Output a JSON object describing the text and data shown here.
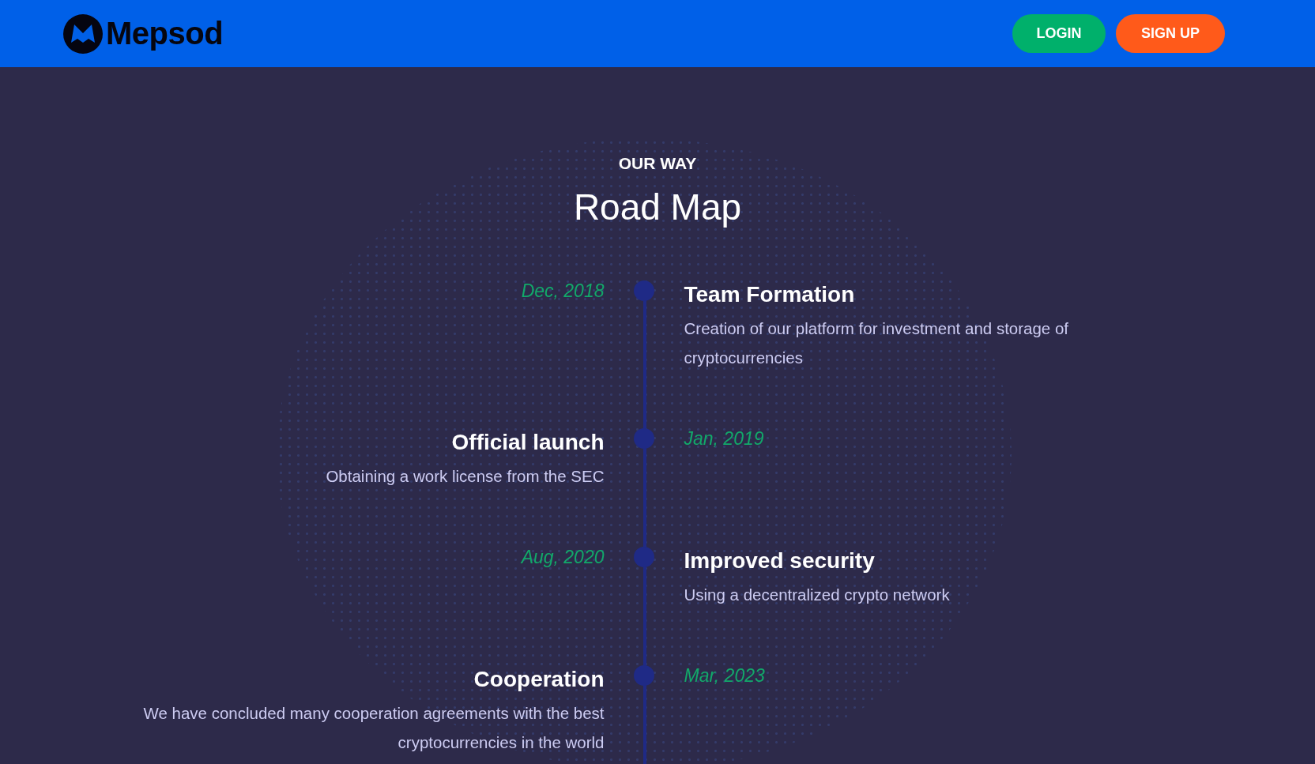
{
  "header": {
    "logo_text": "Mepsod",
    "buttons": [
      {
        "label": "LOGIN",
        "kind": "login"
      },
      {
        "label": "SIGN UP",
        "kind": "signup"
      }
    ]
  },
  "section": {
    "eyebrow": "OUR WAY",
    "title": "Road Map"
  },
  "milestones": [
    {
      "date": "Dec, 2018",
      "title": "Team Formation",
      "description": "Creation of our platform for investment and storage of cryptocurrencies",
      "text_on_left": false
    },
    {
      "date": "Jan, 2019",
      "title": "Official launch",
      "description": "Obtaining a work license from the SEC",
      "text_on_left": true
    },
    {
      "date": "Aug, 2020",
      "title": "Improved security",
      "description": "Using a decentralized crypto network",
      "text_on_left": false
    },
    {
      "date": "Mar, 2023",
      "title": "Cooperation",
      "description": "We have concluded many cooperation agreements with the best cryptocurrencies in the world",
      "text_on_left": true
    }
  ]
}
